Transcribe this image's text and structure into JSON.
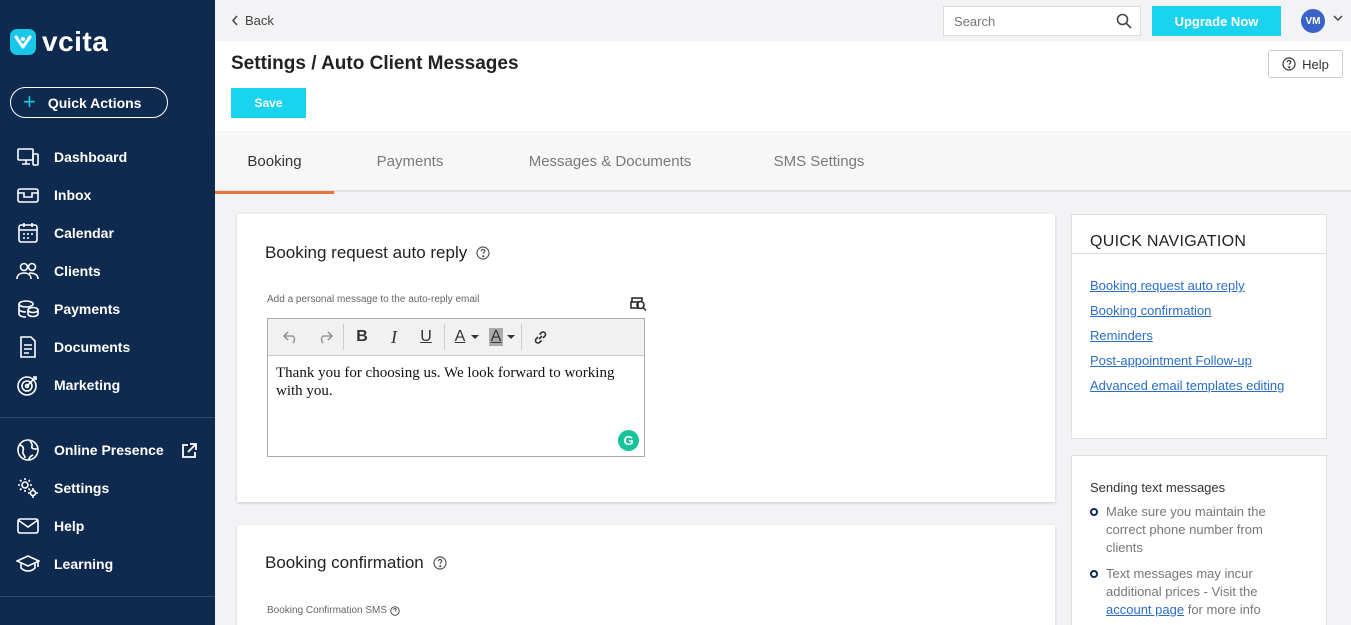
{
  "sidebar": {
    "logo_text": "vcita",
    "quick_actions_label": "Quick Actions",
    "items": [
      {
        "label": "Dashboard",
        "icon": "dashboard-icon"
      },
      {
        "label": "Inbox",
        "icon": "inbox-icon"
      },
      {
        "label": "Calendar",
        "icon": "calendar-icon"
      },
      {
        "label": "Clients",
        "icon": "clients-icon"
      },
      {
        "label": "Payments",
        "icon": "payments-icon"
      },
      {
        "label": "Documents",
        "icon": "documents-icon"
      },
      {
        "label": "Marketing",
        "icon": "marketing-icon"
      },
      {
        "label": "Online Presence",
        "icon": "globe-icon"
      },
      {
        "label": "Settings",
        "icon": "settings-icon"
      },
      {
        "label": "Help",
        "icon": "help-icon"
      },
      {
        "label": "Learning",
        "icon": "learning-icon"
      }
    ]
  },
  "topbar": {
    "back_label": "Back",
    "search_placeholder": "Search",
    "upgrade_label": "Upgrade Now",
    "avatar_initials": "VM"
  },
  "header": {
    "title": "Settings / Auto Client Messages",
    "save_label": "Save",
    "help_label": "Help"
  },
  "tabs": [
    {
      "label": "Booking",
      "active": true
    },
    {
      "label": "Payments",
      "active": false
    },
    {
      "label": "Messages & Documents",
      "active": false
    },
    {
      "label": "SMS Settings",
      "active": false
    }
  ],
  "cards": {
    "booking_request": {
      "title": "Booking request auto reply",
      "field_label": "Add a personal message to the auto-reply email",
      "message": "Thank you for choosing us. We look forward to working with you."
    },
    "booking_confirmation": {
      "title": "Booking confirmation",
      "field_label": "Booking Confirmation SMS"
    }
  },
  "quick_navigation": {
    "title": "QUICK NAVIGATION",
    "links": [
      "Booking request auto reply",
      "Booking confirmation",
      "Reminders",
      "Post-appointment Follow-up",
      "Advanced email templates editing"
    ]
  },
  "sending_text": {
    "title": "Sending text messages",
    "item1": "Make sure you maintain the correct phone number from clients",
    "item2_prefix": "Text messages may incur additional prices - Visit the",
    "item2_link": "account page",
    "item2_suffix": "for more info"
  },
  "colors": {
    "sidebar_bg": "#0f2a4f",
    "accent_cyan": "#19d3ef",
    "tab_underline": "#e8743b",
    "link": "#2a6ec8"
  }
}
